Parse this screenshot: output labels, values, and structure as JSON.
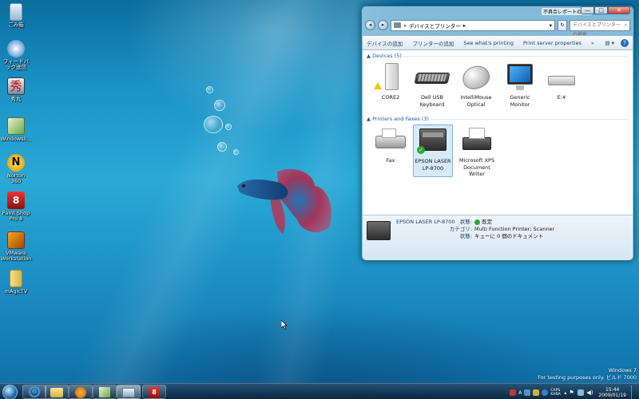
{
  "desktop": {
    "icons": [
      {
        "label": "ごみ箱",
        "icon": "recycle-bin-icon"
      },
      {
        "label": "フィードバック送信",
        "icon": "feedback-icon"
      },
      {
        "label": "秀丸",
        "icon": "hidemaru-icon"
      },
      {
        "label": "Windowsli...",
        "icon": "windows-live-icon"
      },
      {
        "label": "Norton 360",
        "icon": "norton-icon"
      },
      {
        "label": "Paint Shop Pro 8",
        "icon": "paint-shop-pro-icon"
      },
      {
        "label": "VMware Workstation",
        "icon": "vmware-icon"
      },
      {
        "label": "mAgicTV",
        "icon": "magictv-icon"
      }
    ]
  },
  "window": {
    "title": "不具合レポートの送信",
    "buttons": {
      "minimize": "—",
      "maximize": "□",
      "close": "✕"
    },
    "address": {
      "prefix": "«",
      "path": "デバイスとプリンター",
      "arrow": "▸"
    },
    "search_placeholder": "デバイスとプリンター の検索",
    "toolbar": {
      "add_device": "デバイスの追加",
      "add_printer": "プリンターの追加",
      "see_printing": "See what's printing",
      "print_server": "Print server properties",
      "more": "»"
    },
    "devices_group": "Devices (5)",
    "printers_group": "Printers and Faxes (3)",
    "devices": [
      {
        "label": "CORE2",
        "icon": "computer-tower-icon"
      },
      {
        "label": "Dell USB Keyboard",
        "icon": "keyboard-icon"
      },
      {
        "label": "IntelliMouse Optical",
        "icon": "mouse-icon"
      },
      {
        "label": "Generic Monitor",
        "icon": "monitor-icon"
      },
      {
        "label": "E:¥",
        "icon": "drive-icon"
      }
    ],
    "printers": [
      {
        "label": "Fax",
        "icon": "fax-icon"
      },
      {
        "label": "EPSON LASER LP-8700",
        "icon": "printer-icon",
        "selected": true
      },
      {
        "label": "Microsoft XPS Document Writer",
        "icon": "xps-printer-icon"
      }
    ],
    "details": {
      "name": "EPSON LASER LP-8700",
      "status_label": "状態:",
      "status_value": "既定",
      "category_label": "カテゴリ:",
      "category_value": "Multi Function Printer; Scanner",
      "queue_label": "状態:",
      "queue_value": "キューに 0 個のドキュメント"
    }
  },
  "watermark": {
    "line1": "Windows 7",
    "line2": "For testing purposes only. ビルド 7000"
  },
  "taskbar": {
    "apps": [
      "internet-explorer-icon",
      "explorer-icon",
      "media-player-icon",
      "windows-live-icon",
      "devices-icon",
      "paint-shop-pro-icon"
    ],
    "clock_time": "15:44",
    "clock_date": "2009/01/19",
    "ime": "A",
    "caps": "CAPS KANA"
  },
  "colors": {
    "accent": "#1e5aa0",
    "selected": "#d7eafa"
  }
}
